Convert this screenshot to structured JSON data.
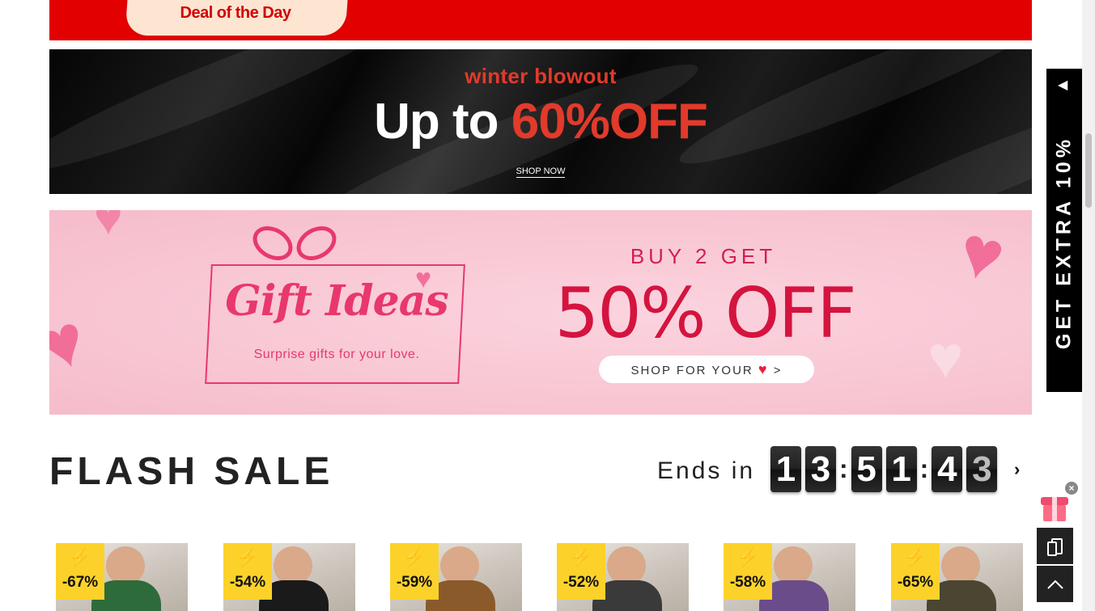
{
  "deal_banner": {
    "label": "Deal of the Day"
  },
  "winter_banner": {
    "subtitle": "winter blowout",
    "title_prefix": "Up to ",
    "title_highlight": "60%OFF",
    "cta": "SHOP NOW"
  },
  "gift_banner": {
    "title": "Gift Ideas",
    "subtitle": "Surprise gifts for your love.",
    "promo_line": "BUY 2 GET",
    "promo_value": "50% OFF",
    "cta_text": "SHOP FOR YOUR",
    "cta_heart": "♥",
    "cta_arrow": ">"
  },
  "flash_sale": {
    "title": "FLASH SALE",
    "ends_label": "Ends in",
    "timer_digits": [
      "1",
      "3",
      "5",
      "1",
      "4",
      "3"
    ],
    "more_icon": "chevron-right"
  },
  "products": [
    {
      "discount": "-67%",
      "accent": "#2e6b3a"
    },
    {
      "discount": "-54%",
      "accent": "#1a1a1a"
    },
    {
      "discount": "-59%",
      "accent": "#8b5a2b"
    },
    {
      "discount": "-52%",
      "accent": "#3a3a3a"
    },
    {
      "discount": "-58%",
      "accent": "#6b4c8a"
    },
    {
      "discount": "-65%",
      "accent": "#4a4632"
    }
  ],
  "side_tab": {
    "label": "GET EXTRA 10%",
    "arrow": "◀"
  },
  "floating": {
    "close": "×",
    "app_icon": "mobile-app-icon",
    "top_icon": "chevron-up-icon"
  },
  "colors": {
    "deal_red": "#e20000",
    "accent_red": "#e23a2b",
    "pink_bg": "#f8c6d3",
    "flash_badge": "#fcd22a"
  }
}
